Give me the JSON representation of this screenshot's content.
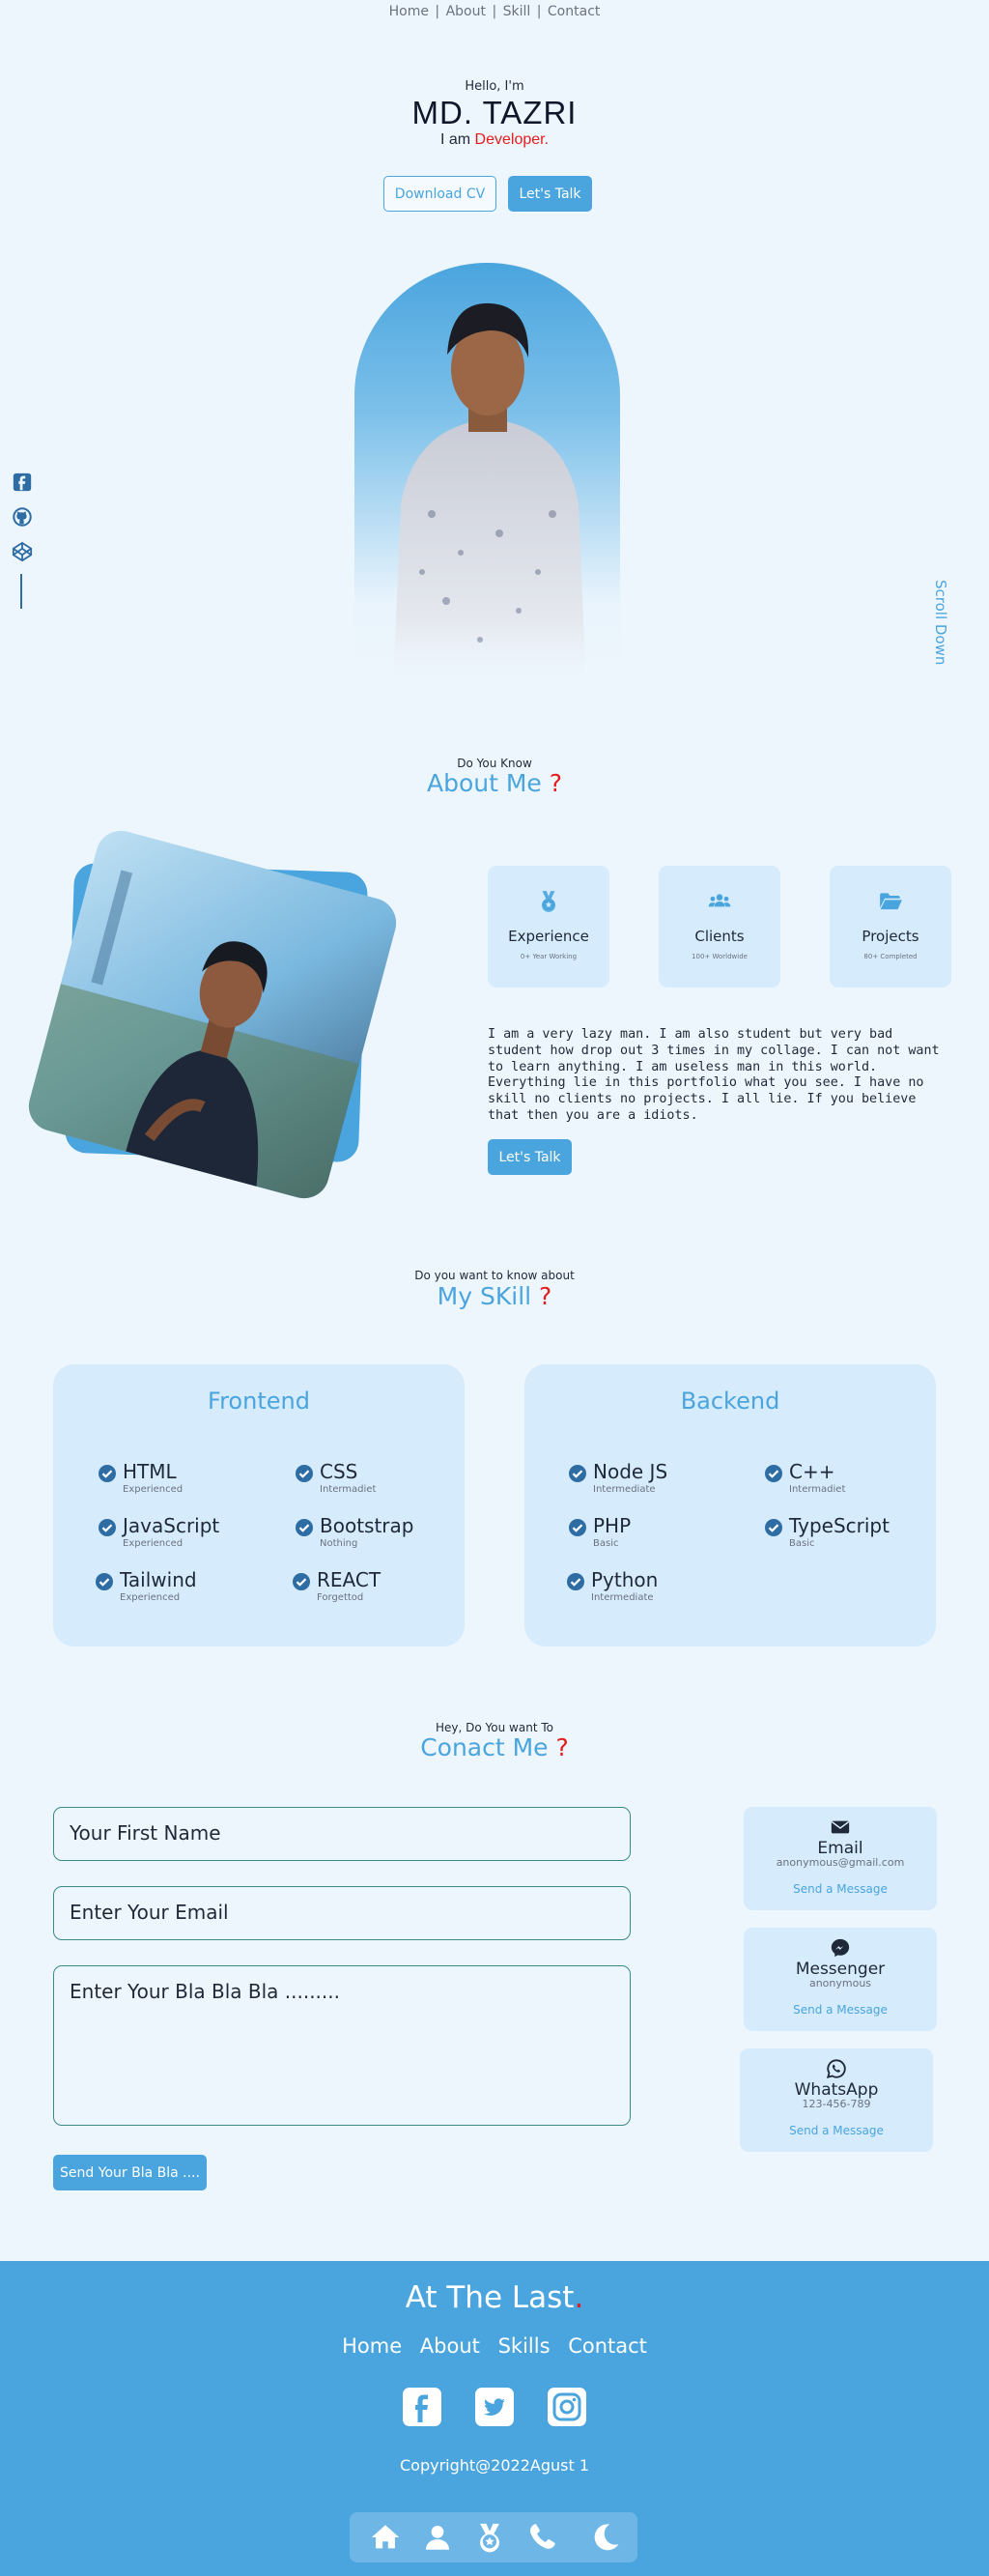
{
  "nav": {
    "items": [
      "Home",
      "About",
      "Skill",
      "Contact"
    ],
    "separator": "|"
  },
  "hero": {
    "greeting": "Hello, I'm",
    "name": "MD. TAZRI",
    "role_prefix": "I am",
    "role": "Developer.",
    "download_cv": "Download CV",
    "lets_talk": "Let's Talk",
    "scroll_down": "Scroll Down"
  },
  "side_social": [
    "facebook-icon",
    "github-icon",
    "codepen-icon"
  ],
  "about": {
    "pre": "Do You Know",
    "title": "About Me",
    "q": "?",
    "stats": [
      {
        "title": "Experience",
        "sub": "0+ Year Working",
        "icon": "medal-icon"
      },
      {
        "title": "Clients",
        "sub": "100+ Worldwide",
        "icon": "users-icon"
      },
      {
        "title": "Projects",
        "sub": "80+ Completed",
        "icon": "folder-icon"
      }
    ],
    "text": "I am a very lazy man. I am also student but very bad student how drop out 3 times in my collage. I can not want to learn anything. I am useless man in this world. Everything lie in this portfolio what you see. I have no skill no clients no projects. I all lie. If you believe that then you are a idiots.",
    "button": "Let's Talk"
  },
  "skills": {
    "pre": "Do you want to know about",
    "title": "My SKill",
    "q": "?",
    "frontend": {
      "title": "Frontend",
      "items": [
        {
          "name": "HTML",
          "level": "Experienced"
        },
        {
          "name": "CSS",
          "level": "Intermadiet"
        },
        {
          "name": "JavaScript",
          "level": "Experienced"
        },
        {
          "name": "Bootstrap",
          "level": "Nothing"
        },
        {
          "name": "Tailwind",
          "level": "Experienced"
        },
        {
          "name": "REACT",
          "level": "Forgettod"
        }
      ]
    },
    "backend": {
      "title": "Backend",
      "items": [
        {
          "name": "Node JS",
          "level": "Intermediate"
        },
        {
          "name": "C++",
          "level": "Intermadiet"
        },
        {
          "name": "PHP",
          "level": "Basic"
        },
        {
          "name": "TypeScript",
          "level": "Basic"
        },
        {
          "name": "Python",
          "level": "Intermediate"
        }
      ]
    }
  },
  "contact": {
    "pre": "Hey, Do You want To",
    "title": "Conact Me",
    "q": "?",
    "first_name_placeholder": "Your First Name",
    "email_placeholder": "Enter Your Email",
    "message_placeholder": "Enter Your Bla Bla Bla .........",
    "send": "Send Your Bla Bla ....",
    "cards": [
      {
        "title": "Email",
        "value": "anonymous@gmail.com",
        "link": "Send a Message",
        "icon": "envelope-icon"
      },
      {
        "title": "Messenger",
        "value": "anonymous",
        "link": "Send a Message",
        "icon": "messenger-icon"
      },
      {
        "title": "WhatsApp",
        "value": "123-456-789",
        "link": "Send a Message",
        "icon": "whatsapp-icon"
      }
    ]
  },
  "footer": {
    "title": "At The Last",
    "dot": ".",
    "nav": [
      "Home",
      "About",
      "Skills",
      "Contact"
    ],
    "social": [
      "facebook-icon",
      "twitter-icon",
      "instagram-icon"
    ],
    "copyright": "Copyright@2022Agust 1"
  },
  "bottom_bar": [
    "home-icon",
    "user-icon",
    "medal-icon",
    "phone-icon",
    "moon-icon"
  ],
  "colors": {
    "accent": "#4aa5de",
    "red": "#e11d1d",
    "bg": "#eef6fd",
    "card": "#d6ebfb",
    "dark_blue": "#2e6da4"
  }
}
